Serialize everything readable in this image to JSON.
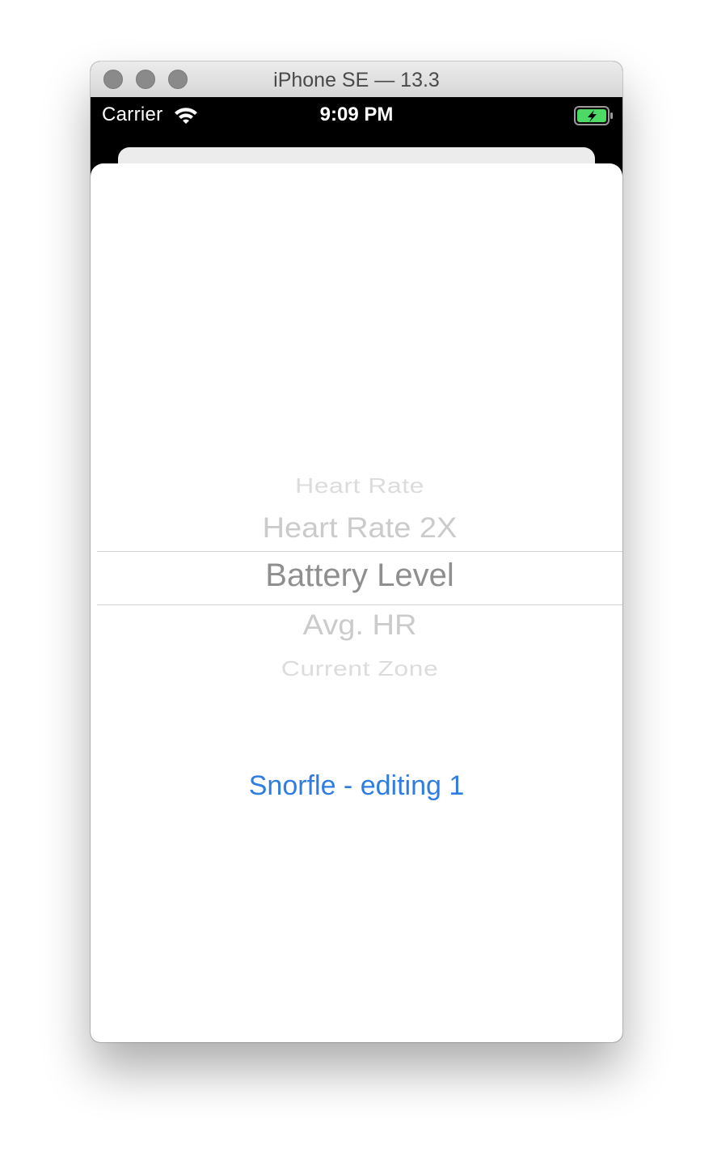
{
  "window": {
    "title": "iPhone SE — 13.3"
  },
  "statusbar": {
    "carrier": "Carrier",
    "time": "9:09 PM",
    "wifi_icon": "wifi-icon",
    "battery_icon": "battery-charging-icon",
    "battery_color": "#4cd964"
  },
  "picker": {
    "items": [
      "Heart Rate",
      "Heart Rate 2X",
      "Battery Level",
      "Avg. HR",
      "Current Zone"
    ],
    "selected": "Battery Level"
  },
  "action": {
    "label": "Snorfle - editing 1",
    "color": "#2f7de1"
  }
}
